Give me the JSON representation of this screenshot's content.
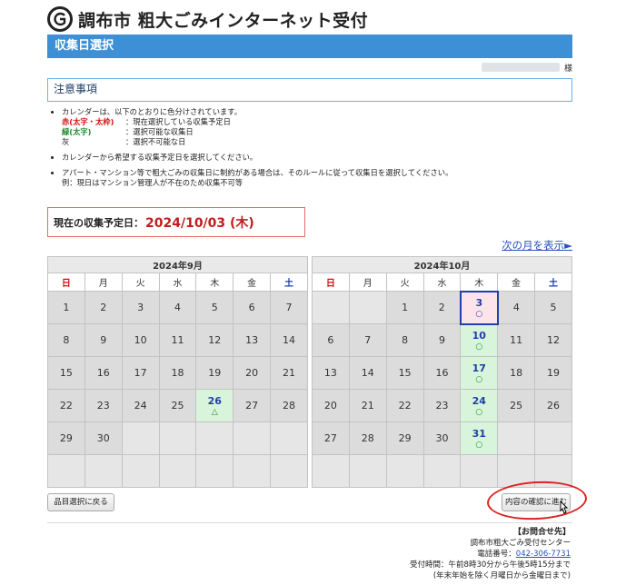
{
  "header": {
    "site_title": "調布市 粗大ごみインターネット受付",
    "page_heading": "収集日選択",
    "user_suffix": "様"
  },
  "notice": {
    "title": "注意事項",
    "bullets": {
      "b1": "カレンダーは、以下のとおりに色分けされています。",
      "legend_red_key": "赤(太字・太枠)",
      "legend_red_desc": "：現在選択している収集予定日",
      "legend_green_key": "緑(太字)",
      "legend_green_desc": "：選択可能な収集日",
      "legend_gray_key": "灰",
      "legend_gray_desc": "：選択不可能な日",
      "b2": "カレンダーから希望する収集予定日を選択してください。",
      "b3": "アパート・マンション等で粗大ごみの収集日に制約がある場合は、そのルールに従って収集日を選択してください。",
      "b3_example": "例：現日はマンション管理人が不在のため収集不可等"
    }
  },
  "current": {
    "label": "現在の収集予定日：",
    "date": "2024/10/03 (木)"
  },
  "next_month_link": "次の月を表示►",
  "dow": [
    "日",
    "月",
    "火",
    "水",
    "木",
    "金",
    "土"
  ],
  "september": {
    "title": "2024年9月",
    "rows": [
      [
        {
          "d": "1"
        },
        {
          "d": "2"
        },
        {
          "d": "3"
        },
        {
          "d": "4"
        },
        {
          "d": "5"
        },
        {
          "d": "6"
        },
        {
          "d": "7"
        }
      ],
      [
        {
          "d": "8"
        },
        {
          "d": "9"
        },
        {
          "d": "10"
        },
        {
          "d": "11"
        },
        {
          "d": "12"
        },
        {
          "d": "13"
        },
        {
          "d": "14"
        }
      ],
      [
        {
          "d": "15"
        },
        {
          "d": "16"
        },
        {
          "d": "17"
        },
        {
          "d": "18"
        },
        {
          "d": "19"
        },
        {
          "d": "20"
        },
        {
          "d": "21"
        }
      ],
      [
        {
          "d": "22"
        },
        {
          "d": "23"
        },
        {
          "d": "24"
        },
        {
          "d": "25"
        },
        {
          "d": "26",
          "s": "avail",
          "m": "△"
        },
        {
          "d": "27"
        },
        {
          "d": "28"
        }
      ],
      [
        {
          "d": "29"
        },
        {
          "d": "30"
        },
        {
          "d": ""
        },
        {
          "d": ""
        },
        {
          "d": ""
        },
        {
          "d": ""
        },
        {
          "d": ""
        }
      ],
      [
        {
          "d": ""
        },
        {
          "d": ""
        },
        {
          "d": ""
        },
        {
          "d": ""
        },
        {
          "d": ""
        },
        {
          "d": ""
        },
        {
          "d": ""
        }
      ]
    ]
  },
  "october": {
    "title": "2024年10月",
    "rows": [
      [
        {
          "d": ""
        },
        {
          "d": ""
        },
        {
          "d": "1"
        },
        {
          "d": "2"
        },
        {
          "d": "3",
          "s": "sel",
          "m": "○"
        },
        {
          "d": "4"
        },
        {
          "d": "5"
        }
      ],
      [
        {
          "d": "6"
        },
        {
          "d": "7"
        },
        {
          "d": "8"
        },
        {
          "d": "9"
        },
        {
          "d": "10",
          "s": "avail",
          "m": "○"
        },
        {
          "d": "11"
        },
        {
          "d": "12"
        }
      ],
      [
        {
          "d": "13"
        },
        {
          "d": "14"
        },
        {
          "d": "15"
        },
        {
          "d": "16"
        },
        {
          "d": "17",
          "s": "avail",
          "m": "○"
        },
        {
          "d": "18"
        },
        {
          "d": "19"
        }
      ],
      [
        {
          "d": "20"
        },
        {
          "d": "21"
        },
        {
          "d": "22"
        },
        {
          "d": "23"
        },
        {
          "d": "24",
          "s": "avail",
          "m": "○"
        },
        {
          "d": "25"
        },
        {
          "d": "26"
        }
      ],
      [
        {
          "d": "27"
        },
        {
          "d": "28"
        },
        {
          "d": "29"
        },
        {
          "d": "30"
        },
        {
          "d": "31",
          "s": "avail",
          "m": "○"
        },
        {
          "d": ""
        },
        {
          "d": ""
        }
      ],
      [
        {
          "d": ""
        },
        {
          "d": ""
        },
        {
          "d": ""
        },
        {
          "d": ""
        },
        {
          "d": ""
        },
        {
          "d": ""
        },
        {
          "d": ""
        }
      ]
    ]
  },
  "buttons": {
    "back": "品目選択に戻る",
    "next": "内容の確認に進む"
  },
  "contact": {
    "heading": "【お問合せ先】",
    "center": "調布市粗大ごみ受付センター",
    "tel_label": "電話番号：",
    "tel": "042-306-7731",
    "hours": "受付時間：午前8時30分から午後5時15分まで",
    "hours_note": "(年末年始を除く月曜日から金曜日まで)"
  },
  "colors": {
    "accent_blue": "#3d8fd6",
    "selected_red": "#c21d1d",
    "available_green": "#d8f5db",
    "link_blue": "#2a52be"
  }
}
